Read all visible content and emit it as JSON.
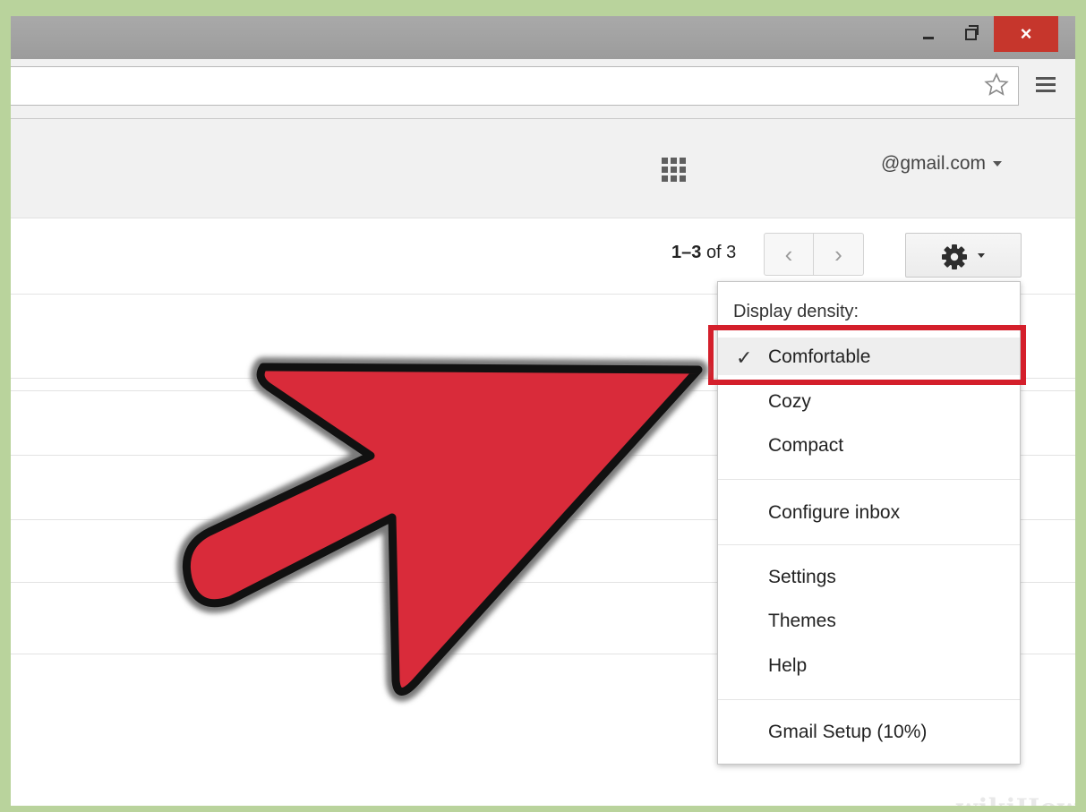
{
  "window": {
    "close_glyph": "×"
  },
  "header": {
    "account": "@gmail.com"
  },
  "toolbar": {
    "range": "1–3",
    "of_text": "of 3",
    "prev_glyph": "‹",
    "next_glyph": "›"
  },
  "settings_menu": {
    "heading": "Display density:",
    "check_glyph": "✓",
    "density_options": [
      "Comfortable",
      "Cozy",
      "Compact"
    ],
    "selected_density": "Comfortable",
    "configure": "Configure inbox",
    "general_items": [
      "Settings",
      "Themes",
      "Help"
    ],
    "setup": "Gmail Setup (10%)"
  },
  "colors": {
    "frame_border": "#b9d39c",
    "arrow_fill": "#d92b3a",
    "highlight_border": "#d41f2b",
    "close_button": "#c6362c"
  },
  "watermark": {
    "brand": "wikiHow"
  }
}
